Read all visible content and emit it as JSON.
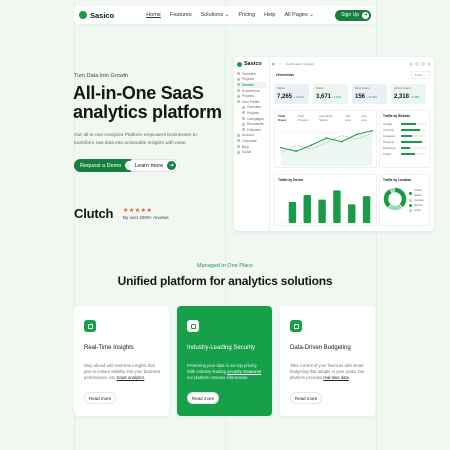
{
  "nav": {
    "logo": "Sasico",
    "menu": [
      "Home",
      "Features",
      "Solutions",
      "Pricing",
      "Help",
      "All Pages"
    ],
    "signup": "Sign Up"
  },
  "hero": {
    "eyebrow": "Turn Data Into Growth",
    "title_line1": "All-in-One SaaS",
    "title_line2": "analytics platform",
    "lead": "Our all-in-one Analytics Platform empowers businesses to transform raw data into actionable insights with ease.",
    "cta_primary": "Request a Demo",
    "cta_secondary": "Learn more",
    "clutch_logo": "Clutch",
    "stars": "★★★★★",
    "rating_count": 5,
    "reviews": "By over 2500+ reviews"
  },
  "dashboard": {
    "logo": "Sasico",
    "sidebar_items": [
      {
        "label": "Overview",
        "selected": false
      },
      {
        "label": "Projects",
        "selected": false
      },
      {
        "label": "Member",
        "selected": true
      },
      {
        "label": "Ecommerce",
        "selected": false
      },
      {
        "label": "Projects",
        "selected": false
      },
      {
        "label": "User Profile",
        "selected": false
      },
      {
        "label": "Overview",
        "selected": false
      },
      {
        "label": "Projects",
        "selected": false
      },
      {
        "label": "Campaigns",
        "selected": false
      },
      {
        "label": "Documents",
        "selected": false
      },
      {
        "label": "Followers",
        "selected": false
      },
      {
        "label": "Account",
        "selected": false
      },
      {
        "label": "Corporate",
        "selected": false
      },
      {
        "label": "Blog",
        "selected": false
      },
      {
        "label": "Social",
        "selected": false
      }
    ],
    "breadcrumb": "Dashboards / Default",
    "overview_title": "Overview",
    "date_filter": "Today",
    "kpis": [
      {
        "label": "Views",
        "value": "7,265",
        "change": "+11.01%"
      },
      {
        "label": "Visits",
        "value": "3,671",
        "change": "-0.03%"
      },
      {
        "label": "New Users",
        "value": "156",
        "change": "+15.03%"
      },
      {
        "label": "Active Users",
        "value": "2,318",
        "change": "+6.08%"
      }
    ],
    "line_chart": {
      "tabs": [
        "Total Users",
        "Total Projects",
        "Operating Status",
        "This year",
        "Last year"
      ],
      "this_year": [
        12,
        9,
        14,
        20,
        17,
        23,
        26
      ],
      "last_year": [
        8,
        14,
        11,
        16,
        22,
        19,
        24
      ]
    },
    "traffic_website": {
      "title": "Traffic by Website",
      "sites": [
        {
          "name": "Google",
          "level": 0.6
        },
        {
          "name": "YouTube",
          "level": 0.75
        },
        {
          "name": "Instagram",
          "level": 0.45
        },
        {
          "name": "Pinterest",
          "level": 0.85
        },
        {
          "name": "Facebook",
          "level": 0.35
        },
        {
          "name": "Twitter",
          "level": 0.55
        }
      ]
    },
    "traffic_device": {
      "title": "Traffic by Device",
      "values": [
        18,
        24,
        20,
        28,
        16,
        23
      ]
    },
    "traffic_location": {
      "title": "Traffic by Location",
      "legend": [
        "United States",
        "Canada",
        "Mexico",
        "Other"
      ],
      "shares": [
        38.6,
        22.5,
        30.8,
        8.1
      ]
    }
  },
  "section": {
    "eyebrow": "Managed in One Place",
    "title": "Unified platform for analytics solutions"
  },
  "cards": [
    {
      "title": "Real-Time Insights",
      "desc_before": "Stay ahead with real-time insights that give to instant visibility into your business performance into ",
      "link": "SaaS analytics",
      "desc_after": "",
      "button": "Read more",
      "icon": "clock-icon"
    },
    {
      "title": "Industry-Leading Security",
      "desc_before": "Protecting your data is our top priority. With industry-leading ",
      "link": "security measures",
      "desc_after": " our platform ensures information.",
      "button": "Read more",
      "icon": "shield-icon"
    },
    {
      "title": "Data-Driven Budgeting",
      "desc_before": "Take control of your finances with smart budgeting that adapts to your goals. Our platform provides ",
      "link": "real-time data",
      "desc_after": "",
      "button": "Read more",
      "icon": "budget-icon"
    }
  ]
}
